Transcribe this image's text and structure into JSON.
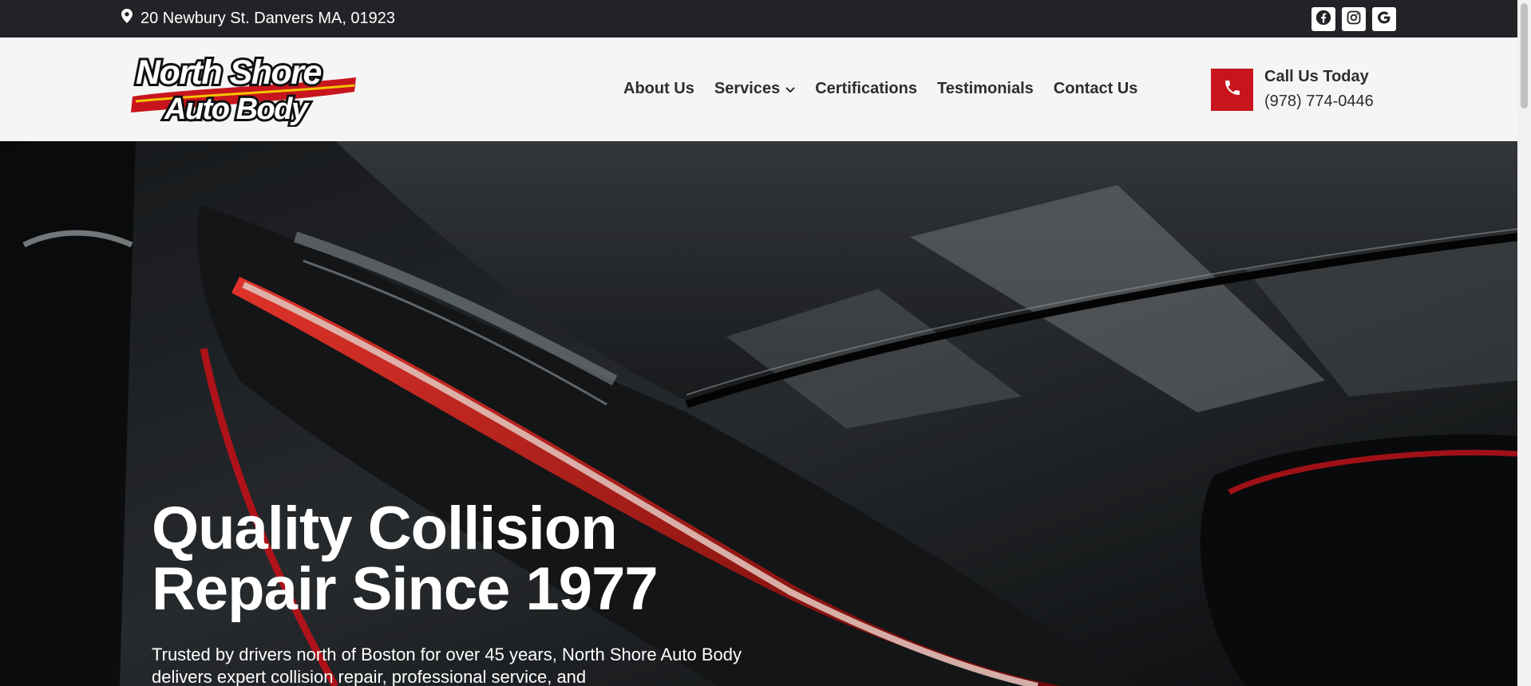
{
  "topbar": {
    "address": "20 Newbury St. Danvers MA, 01923",
    "socials": [
      {
        "name": "facebook-icon"
      },
      {
        "name": "instagram-icon"
      },
      {
        "name": "google-icon"
      }
    ]
  },
  "logo": {
    "line1": "North Shore",
    "line2": "Auto Body"
  },
  "nav": {
    "about": "About Us",
    "services": "Services",
    "certifications": "Certifications",
    "testimonials": "Testimonials",
    "contact": "Contact Us"
  },
  "call": {
    "label": "Call Us Today",
    "number": "(978) 774-0446"
  },
  "hero": {
    "title_line1": "Quality Collision",
    "title_line2": "Repair Since 1977",
    "description": "Trusted by drivers north of Boston for over 45 years, North Shore Auto Body delivers expert collision repair, professional service, and"
  },
  "colors": {
    "accent": "#c8151d",
    "topbar": "#222326",
    "header": "#f5f5f5"
  }
}
